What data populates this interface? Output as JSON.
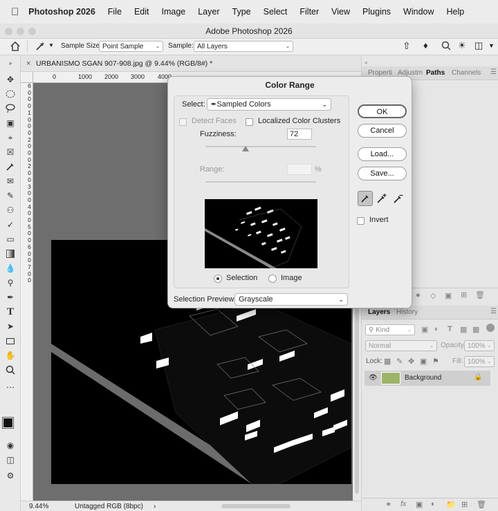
{
  "menubar": {
    "app_name": "Photoshop 2026",
    "items": [
      "File",
      "Edit",
      "Image",
      "Layer",
      "Type",
      "Select",
      "Filter",
      "View",
      "Plugins",
      "Window",
      "Help"
    ]
  },
  "window": {
    "title": "Adobe Photoshop 2026"
  },
  "options_bar": {
    "sample_size_label": "Sample Size:",
    "sample_size_value": "Point Sample",
    "sample_label": "Sample:",
    "sample_value": "All Layers"
  },
  "document": {
    "tab_title": "URBANISMO SGAN 907-908.jpg @ 9.44% (RGB/8#) *",
    "ruler_h": [
      "0",
      "1000",
      "2000",
      "3000",
      "4000"
    ],
    "ruler_v": [
      "6",
      "0",
      "0",
      "0",
      "1",
      "0",
      "0",
      "0",
      "2",
      "0",
      "0",
      "0",
      "2",
      "0",
      "0",
      "3",
      "0",
      "0",
      "4",
      "0",
      "0",
      "5",
      "0",
      "0",
      "6",
      "0",
      "0",
      "7",
      "0",
      "0"
    ]
  },
  "status": {
    "zoom": "9.44%",
    "profile": "Untagged RGB (8bpc)"
  },
  "panels": {
    "top_tabs": [
      "Properti",
      "Adjustm",
      "Paths",
      "Channels"
    ],
    "active_top_tab": "Paths",
    "bottom_tabs": [
      "Layers",
      "History"
    ],
    "kind_label": "Kind",
    "blend_mode": "Normal",
    "opacity_label": "Opacity:",
    "opacity_value": "100%",
    "lock_label": "Lock:",
    "fill_label": "Fill:",
    "fill_value": "100%",
    "layer_name": "Background"
  },
  "dialog": {
    "title": "Color Range",
    "select_label": "Select:",
    "select_value": "Sampled Colors",
    "detect_faces": "Detect Faces",
    "localized": "Localized Color Clusters",
    "fuzziness_label": "Fuzziness:",
    "fuzziness_value": "72",
    "fuzziness_fraction": 0.36,
    "range_label": "Range:",
    "range_unit": "%",
    "selection_radio": "Selection",
    "image_radio": "Image",
    "preview_label": "Selection Preview:",
    "preview_value": "Grayscale",
    "buttons": {
      "ok": "OK",
      "cancel": "Cancel",
      "load": "Load...",
      "save": "Save..."
    },
    "invert": "Invert"
  },
  "colors": {
    "accent": "#3a3a3a",
    "panel_bg": "#e6e6e6",
    "canvas": "#6e6e6e"
  }
}
